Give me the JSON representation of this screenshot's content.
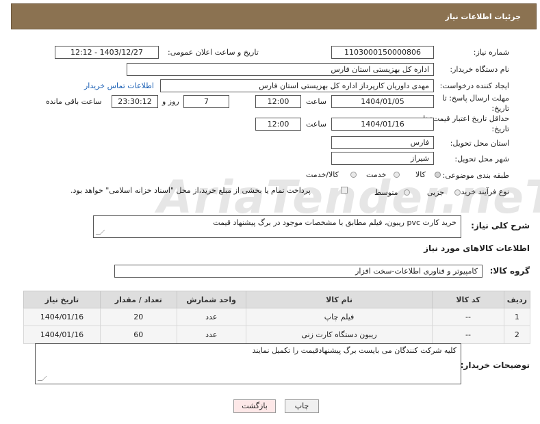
{
  "header": {
    "title": "جزئیات اطلاعات نیاز"
  },
  "fields": {
    "need_number_label": "شماره نیاز:",
    "need_number": "1103000150000806",
    "announce_label": "تاریخ و ساعت اعلان عمومی:",
    "announce_value": "1403/12/27 - 12:12",
    "buyer_org_label": "نام دستگاه خریدار:",
    "buyer_org": "اداره کل بهزیستی استان فارس",
    "requester_label": "ایجاد کننده درخواست:",
    "requester": "مهدی داوریان کارپرداز اداره کل بهزیستی استان فارس",
    "contact_link": "اطلاعات تماس خریدار",
    "deadline_label_1": "مهلت ارسال پاسخ: تا",
    "deadline_label_2": "تاریخ:",
    "deadline_date": "1404/01/05",
    "time_label": "ساعت",
    "deadline_time": "12:00",
    "days_value": "7",
    "days_label": "روز و",
    "remaining_time": "23:30:12",
    "remaining_label": "ساعت باقی مانده",
    "validity_label_1": "حداقل تاریخ اعتبار قیمت: تا",
    "validity_label_2": "تاریخ:",
    "validity_date": "1404/01/16",
    "validity_time": "12:00",
    "province_label": "استان محل تحویل:",
    "province": "فارس",
    "city_label": "شهر محل تحویل:",
    "city": "شیراز",
    "category_label": "طبقه بندی موضوعی:",
    "category_options": [
      "کالا",
      "خدمت",
      "کالا/خدمت"
    ],
    "purchase_type_label": "نوع فرآیند خرید :",
    "purchase_options": [
      "جزیی",
      "متوسط"
    ],
    "payment_note": "پرداخت تمام یا بخشی از مبلغ خرید،از محل \"اسناد خزانه اسلامی\" خواهد بود."
  },
  "description": {
    "label": "شرح کلی نیاز:",
    "value": "خرید کارت pvc ریبون، فیلم مطابق با مشخصات موجود در برگ پیشنهاد قیمت"
  },
  "goods_section": {
    "title": "اطلاعات کالاهای مورد نیاز",
    "group_label": "گروه کالا:",
    "group_value": "کامپیوتر و فناوری اطلاعات-سخت افزار"
  },
  "table": {
    "headers": [
      "ردیف",
      "کد کالا",
      "نام کالا",
      "واحد شمارش",
      "تعداد / مقدار",
      "تاریخ نیاز"
    ],
    "rows": [
      [
        "1",
        "--",
        "فیلم چاپ",
        "عدد",
        "20",
        "1404/01/16"
      ],
      [
        "2",
        "--",
        "ریبون دستگاه کارت زنی",
        "عدد",
        "60",
        "1404/01/16"
      ]
    ]
  },
  "buyer_notes": {
    "label": "توضیحات خریدار:",
    "value": "کلیه شرکت کنندگان می بایست برگ پیشنهادقیمت را تکمیل نمایند"
  },
  "buttons": {
    "print": "چاپ",
    "back": "بازگشت"
  },
  "watermark": "AriaTender.neT",
  "colors": {
    "header": "#8b7251",
    "link": "#1a5fb4",
    "back_button": "#fde8e8",
    "print_button": "#f0f0f0"
  }
}
